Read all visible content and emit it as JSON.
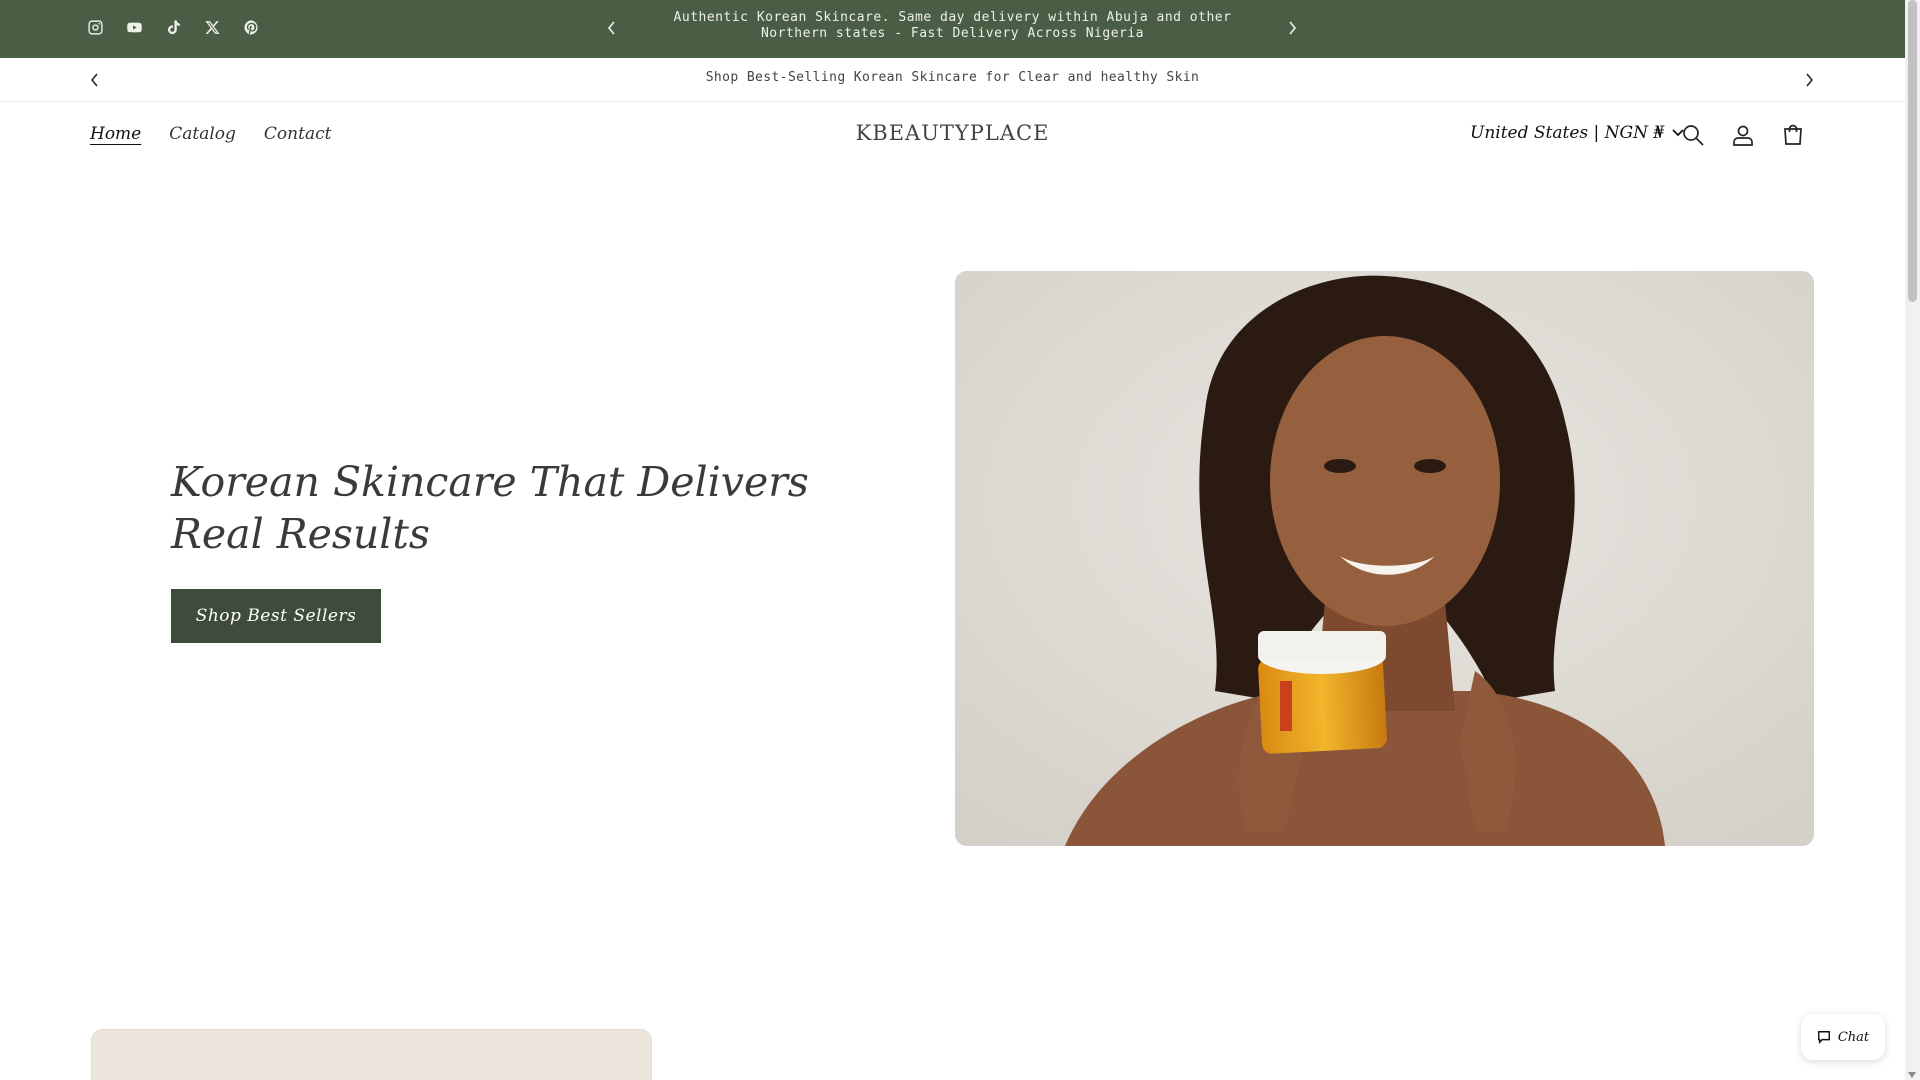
{
  "announcement": {
    "text": "Authentic Korean Skincare. Same day delivery within Abuja and other Northern states - Fast Delivery Across Nigeria",
    "social_icons": [
      "instagram-icon",
      "youtube-icon",
      "tiktok-icon",
      "x-icon",
      "pinterest-icon"
    ],
    "background": "#4a5e45"
  },
  "secondary_bar": {
    "text": "Shop Best-Selling Korean Skincare for Clear and healthy Skin"
  },
  "header": {
    "nav": [
      "Home",
      "Catalog",
      "Contact"
    ],
    "logo": "KBEAUTYPLACE",
    "country_selector": "United States | NGN ₦",
    "icons": [
      "search-icon",
      "account-icon",
      "cart-icon"
    ]
  },
  "hero": {
    "title": "Korean Skincare That Delivers Real Results",
    "button_label": "Shop Best Sellers",
    "button_color": "#3f4c3c"
  },
  "chat": {
    "label": "Chat"
  }
}
